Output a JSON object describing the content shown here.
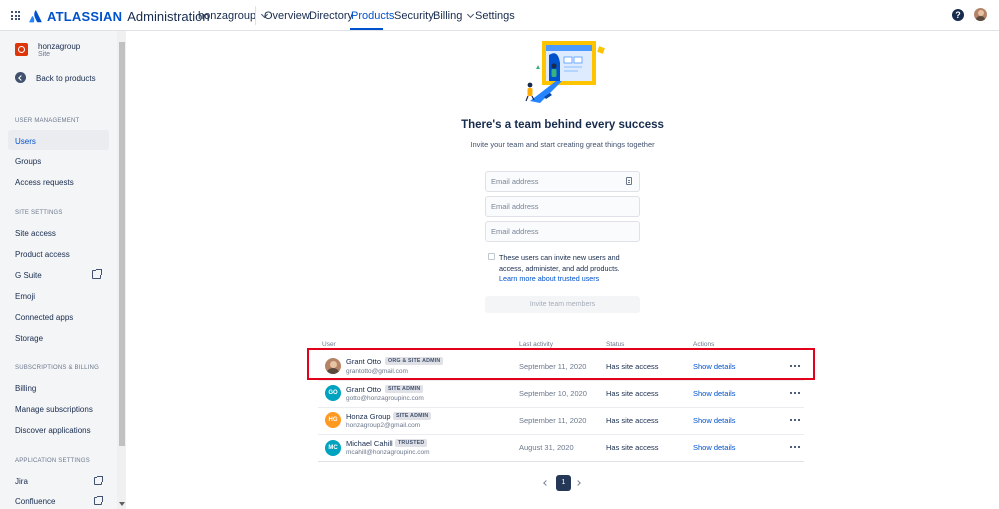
{
  "topnav": {
    "brand": "ATLASSIAN",
    "product": "Administration",
    "site": "honzagroup",
    "links": [
      "Overview",
      "Directory",
      "Products",
      "Security",
      "Billing",
      "Settings"
    ],
    "help_glyph": "?"
  },
  "sidebar": {
    "site_name": "honzagroup",
    "site_sub": "Site",
    "back": "Back to products",
    "sections": {
      "user_management": "USER MANAGEMENT",
      "site_settings": "SITE SETTINGS",
      "subscriptions": "SUBSCRIPTIONS & BILLING",
      "application_settings": "APPLICATION SETTINGS"
    },
    "items": {
      "users": "Users",
      "groups": "Groups",
      "access_requests": "Access requests",
      "site_access": "Site access",
      "product_access": "Product access",
      "gsuite": "G Suite",
      "emoji": "Emoji",
      "connected_apps": "Connected apps",
      "storage": "Storage",
      "billing": "Billing",
      "manage_subscriptions": "Manage subscriptions",
      "discover_applications": "Discover applications",
      "jira": "Jira",
      "confluence": "Confluence"
    }
  },
  "main": {
    "headline": "There's a team behind every success",
    "subline": "Invite your team and start creating great things together",
    "email_placeholder": "Email address",
    "checkbox_text": "These users can invite new users and access, administer, and add products.",
    "learn_more": "Learn more about trusted users",
    "invite_button": "Invite team members"
  },
  "table": {
    "headers": {
      "user": "User",
      "last_activity": "Last activity",
      "status": "Status",
      "actions": "Actions"
    },
    "rows": [
      {
        "name": "Grant Otto",
        "badge": "ORG & SITE ADMIN",
        "email": "grantotto@gmail.com",
        "date": "September 11, 2020",
        "status": "Has site access",
        "action": "Show details",
        "initials": ""
      },
      {
        "name": "Grant Otto",
        "badge": "SITE ADMIN",
        "email": "gotto@honzagroupinc.com",
        "date": "September 10, 2020",
        "status": "Has site access",
        "action": "Show details",
        "initials": "GO"
      },
      {
        "name": "Honza Group",
        "badge": "SITE ADMIN",
        "email": "honzagroup2@gmail.com",
        "date": "September 11, 2020",
        "status": "Has site access",
        "action": "Show details",
        "initials": "HG"
      },
      {
        "name": "Michael Cahill",
        "badge": "TRUSTED",
        "email": "mcahill@honzagroupinc.com",
        "date": "August 31, 2020",
        "status": "Has site access",
        "action": "Show details",
        "initials": "MC"
      }
    ]
  },
  "pagination": {
    "current": "1"
  },
  "colors": {
    "accent": "#0052cc",
    "highlight": "#e2001a",
    "avatar_go": "#00a3bf",
    "avatar_hg": "#ff991f",
    "avatar_mc": "#00a3bf"
  }
}
